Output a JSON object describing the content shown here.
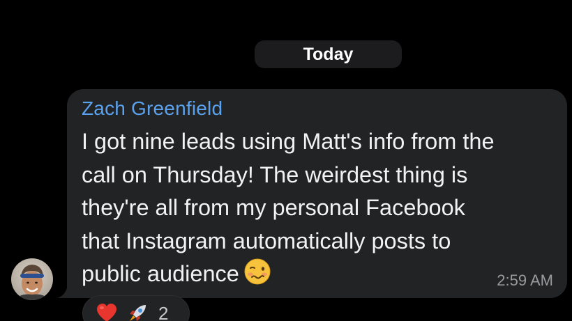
{
  "date_separator": "Today",
  "message": {
    "sender": "Zach Greenfield",
    "lines": [
      "I got nine leads using Matt's info from the",
      "call on Thursday! The weirdest thing is",
      "they're all from my personal Facebook",
      "that Instagram automatically posts to",
      "public audience"
    ],
    "trailing_emoji": "woozy-face-emoji",
    "time": "2:59 AM"
  },
  "reactions": {
    "icons": [
      "red-heart-icon",
      "rocket-icon"
    ],
    "count": "2"
  },
  "colors": {
    "background": "#000000",
    "bubble": "#222325",
    "sender": "#5aa2ef",
    "text": "#f2f2f2",
    "timestamp": "#9a9a9f",
    "date_pill": "#1c1c1e"
  }
}
